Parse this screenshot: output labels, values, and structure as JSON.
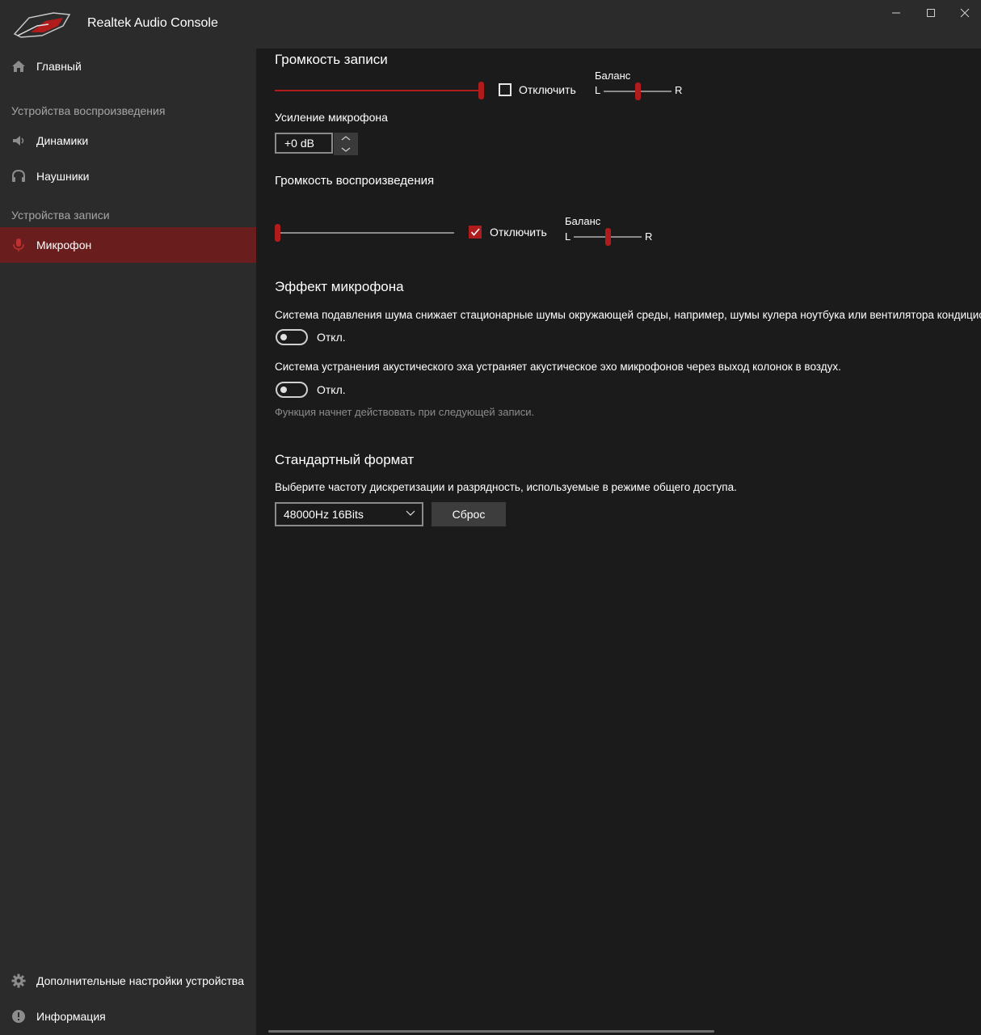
{
  "app": {
    "title": "Realtek Audio Console",
    "accent_color": "#b01c1c",
    "active_bg_color": "#6a1d1d",
    "logo": "rog-eye-logo",
    "window_controls": [
      "minimize-icon",
      "maximize-icon",
      "close-icon"
    ]
  },
  "sidebar": {
    "home": {
      "label": "Главный",
      "icon": "home-icon"
    },
    "playback_header": "Устройства воспроизведения",
    "playback_items": [
      {
        "label": "Динамики",
        "icon": "speaker-icon"
      },
      {
        "label": "Наушники",
        "icon": "headphones-icon"
      }
    ],
    "record_header": "Устройства записи",
    "record_items": [
      {
        "label": "Микрофон",
        "icon": "microphone-icon",
        "active": true
      }
    ],
    "bottom_items": [
      {
        "label": "Дополнительные настройки устройства",
        "icon": "gear-icon"
      },
      {
        "label": "Информация",
        "icon": "info-icon"
      }
    ]
  },
  "record_volume": {
    "title": "Громкость записи",
    "level": 1.0,
    "mute_label": "Отключить",
    "muted": false,
    "balance_label": "Баланс",
    "balance_left": "L",
    "balance_right": "R",
    "balance": 0.5
  },
  "mic_boost": {
    "label": "Усиление микрофона",
    "value": "+0 dB"
  },
  "playback_volume": {
    "title": "Громкость воспроизведения",
    "level": 0.0,
    "mute_label": "Отключить",
    "muted": true,
    "balance_label": "Баланс",
    "balance_left": "L",
    "balance_right": "R",
    "balance": 0.5
  },
  "mic_effects": {
    "title": "Эффект микрофона",
    "noise_suppression_desc": "Система подавления шума снижает стационарные шумы окружающей среды, например, шумы кулера ноутбука или вентилятора кондиционера.",
    "noise_suppression_state": "Откл.",
    "echo_cancel_desc": "Система устранения акустического эха устраняет акустическое эхо микрофонов через выход колонок в воздух.",
    "echo_cancel_state": "Откл.",
    "note": "Функция начнет действовать при следующей записи."
  },
  "default_format": {
    "title": "Стандартный формат",
    "desc": "Выберите частоту дискретизации и разрядность, используемые в режиме общего доступа.",
    "selected": "48000Hz 16Bits",
    "reset_label": "Сброс"
  }
}
